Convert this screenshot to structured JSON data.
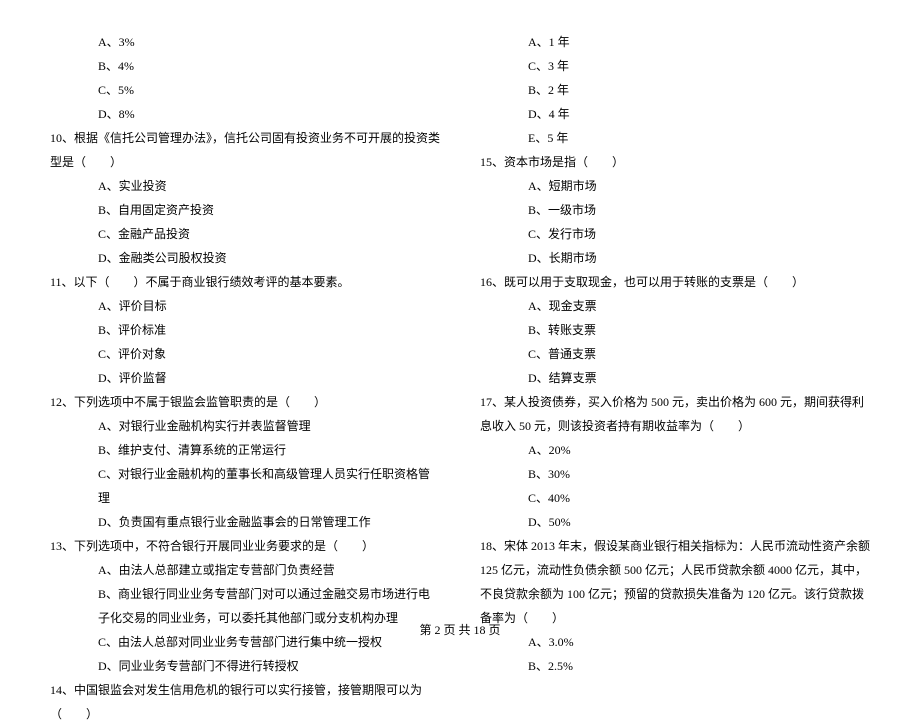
{
  "left": {
    "q9_opts": [
      "A、3%",
      "B、4%",
      "C、5%",
      "D、8%"
    ],
    "q10": "10、根据《信托公司管理办法》，信托公司固有投资业务不可开展的投资类型是（　　）",
    "q10_opts": [
      "A、实业投资",
      "B、自用固定资产投资",
      "C、金融产品投资",
      "D、金融类公司股权投资"
    ],
    "q11": "11、以下（　　）不属于商业银行绩效考评的基本要素。",
    "q11_opts": [
      "A、评价目标",
      "B、评价标准",
      "C、评价对象",
      "D、评价监督"
    ],
    "q12": "12、下列选项中不属于银监会监管职责的是（　　）",
    "q12_opts": [
      "A、对银行业金融机构实行并表监督管理",
      "B、维护支付、清算系统的正常运行",
      "C、对银行业金融机构的董事长和高级管理人员实行任职资格管理",
      "D、负责国有重点银行业金融监事会的日常管理工作"
    ],
    "q13": "13、下列选项中，不符合银行开展同业业务要求的是（　　）",
    "q13_opts": [
      "A、由法人总部建立或指定专营部门负责经营",
      "B、商业银行同业业务专营部门对可以通过金融交易市场进行电子化交易的同业业务，可以委托其他部门或分支机构办理",
      "C、由法人总部对同业业务专营部门进行集中统一授权",
      "D、同业业务专营部门不得进行转授权"
    ],
    "q14": "14、中国银监会对发生信用危机的银行可以实行接管，接管期限可以为（　　）"
  },
  "right": {
    "q14_opts": [
      "A、1 年",
      "C、3 年",
      "B、2 年",
      "D、4 年",
      "E、5 年"
    ],
    "q15": "15、资本市场是指（　　）",
    "q15_opts": [
      "A、短期市场",
      "B、一级市场",
      "C、发行市场",
      "D、长期市场"
    ],
    "q16": "16、既可以用于支取现金，也可以用于转账的支票是（　　）",
    "q16_opts": [
      "A、现金支票",
      "B、转账支票",
      "C、普通支票",
      "D、结算支票"
    ],
    "q17": "17、某人投资债券，买入价格为 500 元，卖出价格为 600 元，期间获得利息收入 50 元，则该投资者持有期收益率为（　　）",
    "q17_opts": [
      "A、20%",
      "B、30%",
      "C、40%",
      "D、50%"
    ],
    "q18": "18、宋体 2013 年末，假设某商业银行相关指标为：人民币流动性资产余额 125 亿元，流动性负债余额 500 亿元；人民币贷款余额 4000 亿元，其中，不良贷款余额为 100 亿元；预留的贷款损失准备为 120 亿元。该行贷款拨备率为（　　）",
    "q18_opts": [
      "A、3.0%",
      "B、2.5%"
    ]
  },
  "footer": "第 2 页 共 18 页"
}
